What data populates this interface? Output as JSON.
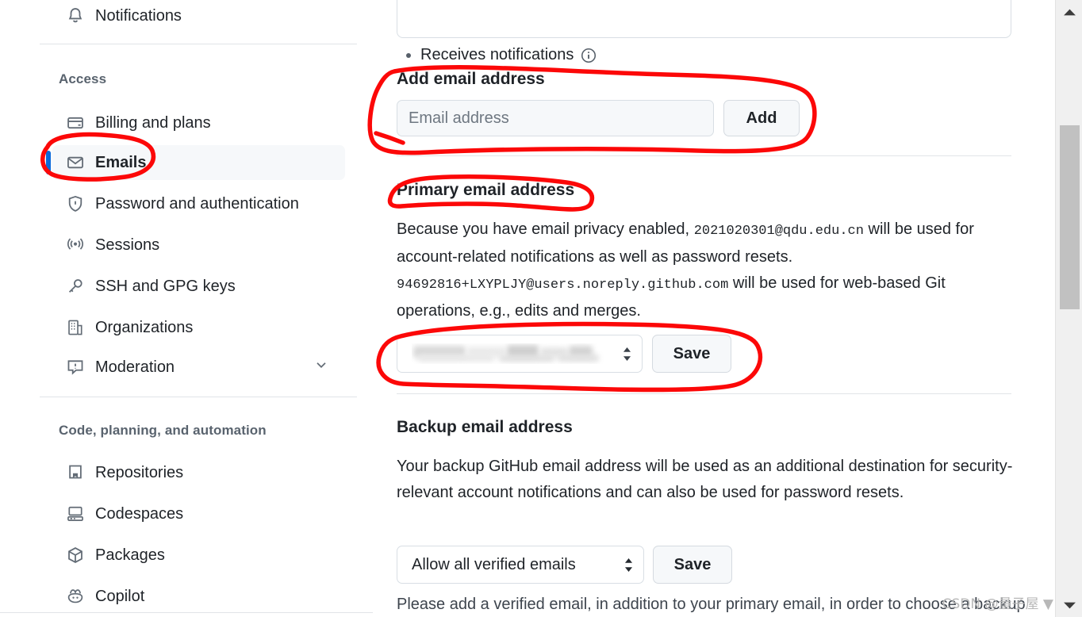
{
  "sidebar": {
    "top_item": {
      "label": "Notifications",
      "icon": "bell-icon"
    },
    "sections": [
      {
        "title": "Access",
        "items": [
          {
            "label": "Billing and plans",
            "icon": "credit-card-icon",
            "active": false
          },
          {
            "label": "Emails",
            "icon": "mail-icon",
            "active": true
          },
          {
            "label": "Password and authentication",
            "icon": "shield-lock-icon",
            "active": false
          },
          {
            "label": "Sessions",
            "icon": "broadcast-icon",
            "active": false
          },
          {
            "label": "SSH and GPG keys",
            "icon": "key-icon",
            "active": false
          },
          {
            "label": "Organizations",
            "icon": "organization-icon",
            "active": false
          },
          {
            "label": "Moderation",
            "icon": "report-icon",
            "active": false,
            "expandable": true
          }
        ]
      },
      {
        "title": "Code, planning, and automation",
        "items": [
          {
            "label": "Repositories",
            "icon": "repo-icon",
            "active": false
          },
          {
            "label": "Codespaces",
            "icon": "codespaces-icon",
            "active": false
          },
          {
            "label": "Packages",
            "icon": "package-icon",
            "active": false
          },
          {
            "label": "Copilot",
            "icon": "copilot-icon",
            "active": false
          }
        ]
      }
    ]
  },
  "main": {
    "notification_card": {
      "bullet_text": "Receives notifications",
      "info_icon": "info-icon"
    },
    "add_email": {
      "heading": "Add email address",
      "input_placeholder": "Email address",
      "input_value": "",
      "button_label": "Add"
    },
    "primary_email": {
      "heading": "Primary email address",
      "para1_prefix": "Because you have email privacy enabled,",
      "para1_email": "2021020301@qdu.edu.cn",
      "para1_suffix": "will be used for account-related notifications as well as password resets.",
      "para2_email": "94692816+LXYPLJY@users.noreply.github.com",
      "para2_suffix": "will be used for web-based Git operations, e.g., edits and merges.",
      "select_value": "",
      "select_redacted": true,
      "save_label": "Save"
    },
    "backup_email": {
      "heading": "Backup email address",
      "description": "Your backup GitHub email address will be used as an additional destination for security-relevant account notifications and can also be used for password resets.",
      "select_value": "Allow all verified emails",
      "save_label": "Save",
      "hint": "Please add a verified email, in addition to your primary email, in order to choose a backup"
    }
  },
  "scrollbar": {
    "up_arrow": "triangle-up-icon",
    "down_arrow": "triangle-down-icon"
  },
  "watermark": {
    "text": "CSDN @量子屋"
  },
  "colors": {
    "accent_blue": "#0969da",
    "annotation_red": "#ff0000",
    "surface": "#f6f8fa",
    "border": "#d8dee4",
    "text": "#1f2328",
    "muted": "#59636e"
  }
}
